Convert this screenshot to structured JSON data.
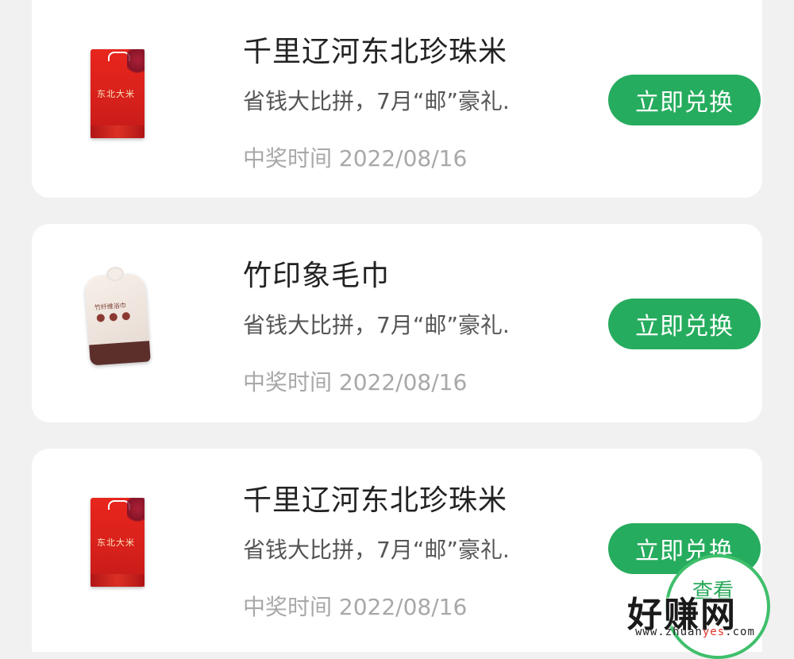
{
  "items": [
    {
      "name": "千里辽河东北珍珠米",
      "desc": "省钱大比拼，7月“邮”豪礼.",
      "time": "中奖时间 2022/08/16",
      "button": "立即兑换",
      "image_icon": "rice-bag-icon"
    },
    {
      "name": "竹印象毛巾",
      "desc": "省钱大比拼，7月“邮”豪礼.",
      "time": "中奖时间 2022/08/16",
      "button": "立即兑换",
      "image_icon": "towel-bag-icon"
    },
    {
      "name": "千里辽河东北珍珠米",
      "desc": "省钱大比拼，7月“邮”豪礼.",
      "time": "中奖时间 2022/08/16",
      "button": "立即兑换",
      "image_icon": "rice-bag-icon"
    }
  ],
  "product_labels": {
    "rice_brand": "东北大米",
    "towel_brand": "竹纤维浴巾"
  },
  "floating_button": {
    "label": "查看"
  },
  "watermark": {
    "main": "好赚网",
    "url_prefix": "www.zhuan",
    "url_highlight": "yes",
    "url_suffix": ".com"
  },
  "colors": {
    "accent_green": "#26ac5e",
    "background": "#f1f1f1",
    "card": "#ffffff"
  }
}
